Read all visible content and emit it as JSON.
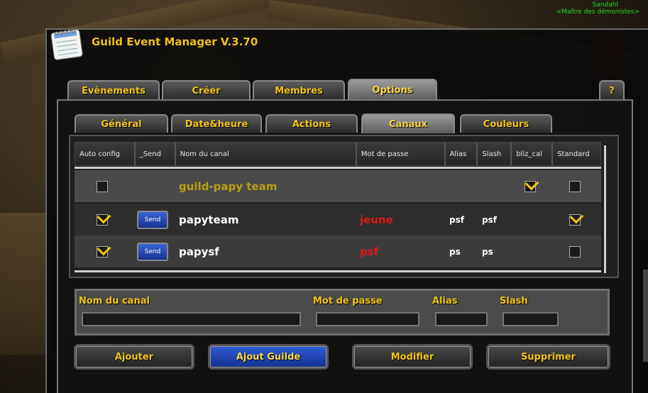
{
  "character": {
    "name": "Sandahl",
    "title": "<Maître des démonistes>"
  },
  "window": {
    "title": "Guild Event Manager V.3.70"
  },
  "main_tabs": [
    {
      "label": "Evènements",
      "active": false
    },
    {
      "label": "Créer",
      "active": false
    },
    {
      "label": "Membres",
      "active": false
    },
    {
      "label": "Options",
      "active": true
    }
  ],
  "help_label": "?",
  "sub_tabs": [
    {
      "label": "Général",
      "active": false
    },
    {
      "label": "Date&heure",
      "active": false
    },
    {
      "label": "Actions",
      "active": false
    },
    {
      "label": "Canaux",
      "active": true
    },
    {
      "label": "Couleurs",
      "active": false
    }
  ],
  "grid": {
    "headers": [
      "Auto config",
      "_Send",
      "Nom du canal",
      "Mot de passe",
      "Alias",
      "Slash",
      "bliz_cal",
      "Standard"
    ],
    "rows": [
      {
        "auto_config": false,
        "send": "",
        "name": "guild-papy team",
        "password": "",
        "alias": "",
        "slash": "",
        "bliz_cal": true,
        "standard": false,
        "is_guild": true
      },
      {
        "auto_config": true,
        "send": "Send",
        "name": "papyteam",
        "password": "jeune",
        "alias": "psf",
        "slash": "psf",
        "bliz_cal": null,
        "standard": true,
        "is_guild": false
      },
      {
        "auto_config": true,
        "send": "Send",
        "name": "papysf",
        "password": "psf",
        "alias": "ps",
        "slash": "ps",
        "bliz_cal": null,
        "standard": false,
        "is_guild": false
      }
    ]
  },
  "form": {
    "name_label": "Nom du canal",
    "password_label": "Mot de passe",
    "alias_label": "Alias",
    "slash_label": "Slash",
    "name_value": "",
    "password_value": "",
    "alias_value": "",
    "slash_value": ""
  },
  "buttons": {
    "add": "Ajouter",
    "add_guild": "Ajout Guilde",
    "modify": "Modifier",
    "delete": "Supprimer"
  },
  "colors": {
    "gold": "#f0c418",
    "password_red": "#e01818",
    "guild_channel": "#b8a010",
    "send_blue": "#3b62d6"
  }
}
